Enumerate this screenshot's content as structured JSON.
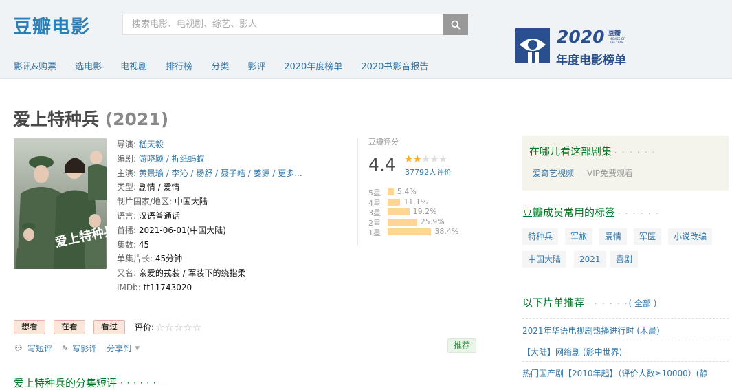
{
  "header": {
    "logo": "豆瓣电影",
    "search_placeholder": "搜索电影、电视剧、综艺、影人",
    "nav": [
      "影讯&购票",
      "选电影",
      "电视剧",
      "排行榜",
      "分类",
      "影评",
      "2020年度榜单",
      "2020书影音报告"
    ],
    "banner": {
      "year": "2020",
      "brand": "豆瓣",
      "sub": "MOVIES OF THE YEAR",
      "title": "年度电影榜单"
    }
  },
  "subject": {
    "title": "爱上特种兵",
    "year": "(2021)",
    "poster_text": "爱上特种兵",
    "info": {
      "director_label": "导演:",
      "director": "嵇天毅",
      "writer_label": "编剧:",
      "writers": "游晓颖 / 折纸蚂蚁",
      "cast_label": "主演:",
      "cast": "黄景瑜 / 李沁 / 杨舒 / 聂子皓 / 姜源 / 更多...",
      "genre_label": "类型:",
      "genre": "剧情 / 爱情",
      "country_label": "制片国家/地区:",
      "country": "中国大陆",
      "language_label": "语言:",
      "language": "汉语普通话",
      "release_label": "首播:",
      "release": "2021-06-01(中国大陆)",
      "episodes_label": "集数:",
      "episodes": "45",
      "runtime_label": "单集片长:",
      "runtime": "45分钟",
      "aka_label": "又名:",
      "aka": "亲爱的戎装 / 军装下的绕指柔",
      "imdb_label": "IMDb:",
      "imdb": "tt11743020"
    }
  },
  "rating": {
    "label": "豆瓣评分",
    "score": "4.4",
    "stars_filled": 2,
    "stars_total": 5,
    "votes": "37792人评价",
    "distribution": [
      {
        "label": "5星",
        "pct": "5.4%",
        "value": 5.4
      },
      {
        "label": "4星",
        "pct": "11.1%",
        "value": 11.1
      },
      {
        "label": "3星",
        "pct": "19.2%",
        "value": 19.2
      },
      {
        "label": "2星",
        "pct": "25.9%",
        "value": 25.9
      },
      {
        "label": "1星",
        "pct": "38.4%",
        "value": 38.4
      }
    ]
  },
  "actions": {
    "want": "想看",
    "watching": "在看",
    "watched": "看过",
    "rate_label": "评价:",
    "short_review": "写短评",
    "review": "写影评",
    "share": "分享到",
    "recommend": "推荐"
  },
  "episodes_section": "爱上特种兵的分集短评 · · · · · ·",
  "sidebar": {
    "watch_title": "在哪儿看这部剧集",
    "watch_dots": "· · · · · ·",
    "watch_provider": "爱奇艺视频",
    "watch_vip": "VIP免费观看",
    "tags_title": "豆瓣成员常用的标签",
    "tags_dots": "· · · · · ·",
    "tags": [
      "特种兵",
      "军旅",
      "爱情",
      "军医",
      "小说改编",
      "中国大陆",
      "2021",
      "喜剧"
    ],
    "lists_title": "以下片单推荐",
    "lists_dots": "· · · · · ·",
    "lists_all": "( 全部 )",
    "lists": [
      "2021年华语电视剧热播进行时 (木晨)",
      "【大陆】网络剧 (影中世界)",
      "热门国产剧【2010年起】（评价人数≥10000）(静"
    ]
  },
  "colors": {
    "link": "#3377aa",
    "section_green": "#007722",
    "star": "#ffac2d",
    "bar": "#ffd596"
  }
}
